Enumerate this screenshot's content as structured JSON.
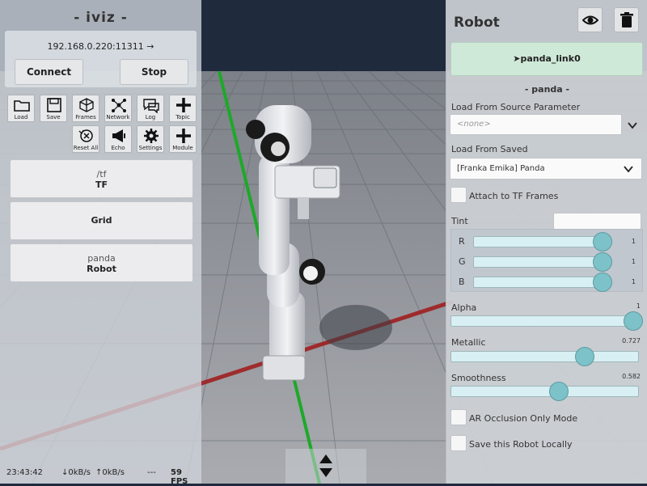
{
  "colors": {
    "sky": "#1f2a3d",
    "floor": "#8d9097",
    "x_axis": "#a01818",
    "y_axis": "#1ea82a",
    "slider_fill": "#d8f0f3",
    "slider_knob": "#7ec2c9",
    "link_button": "#cfe9d8"
  },
  "left_panel": {
    "title": "- iviz -",
    "address": "192.168.0.220:11311 →",
    "connect_label": "Connect",
    "stop_label": "Stop",
    "tools_row1": [
      {
        "label": "Load",
        "icon": "folder-icon"
      },
      {
        "label": "Save",
        "icon": "floppy-icon"
      },
      {
        "label": "Frames",
        "icon": "cube-frames-icon"
      },
      {
        "label": "Network",
        "icon": "network-icon"
      },
      {
        "label": "Log",
        "icon": "chat-log-icon"
      },
      {
        "label": "Topic",
        "icon": "plus-icon"
      }
    ],
    "tools_row2": [
      {
        "label": "Reset All",
        "icon": "reset-icon"
      },
      {
        "label": "Echo",
        "icon": "megaphone-icon"
      },
      {
        "label": "Settings",
        "icon": "gear-icon"
      },
      {
        "label": "Module",
        "icon": "plus-icon"
      }
    ],
    "layers": [
      {
        "sub": "/tf",
        "main": "TF"
      },
      {
        "sub": "",
        "main": "Grid"
      },
      {
        "sub": "panda",
        "main": "Robot"
      }
    ],
    "status": {
      "time": "23:43:42",
      "down": "↓0kB/s",
      "up": "↑0kB/s",
      "dashes": "---",
      "fps": "59 FPS"
    }
  },
  "right_panel": {
    "title": "Robot",
    "link_button_label": "➤panda_link0",
    "robot_name": "- panda -",
    "source_param_label": "Load From Source Parameter",
    "source_param_placeholder": "<none>",
    "saved_label": "Load From Saved",
    "saved_value": "[Franka Emika] Panda",
    "attach_label": "Attach to TF Frames",
    "attach_checked": false,
    "tint_label": "Tint",
    "tint": {
      "r": {
        "label": "R",
        "value": "1",
        "level": 1.0
      },
      "g": {
        "label": "G",
        "value": "1",
        "level": 1.0
      },
      "b": {
        "label": "B",
        "value": "1",
        "level": 1.0
      }
    },
    "alpha": {
      "label": "Alpha",
      "value": "1",
      "level": 1.0
    },
    "metallic": {
      "label": "Metallic",
      "value": "0.727",
      "level": 0.727
    },
    "smoothness": {
      "label": "Smoothness",
      "value": "0.582",
      "level": 0.582
    },
    "ar_occlusion_label": "AR Occlusion Only Mode",
    "ar_occlusion_checked": false,
    "save_locally_label": "Save this Robot Locally",
    "save_locally_checked": false
  }
}
